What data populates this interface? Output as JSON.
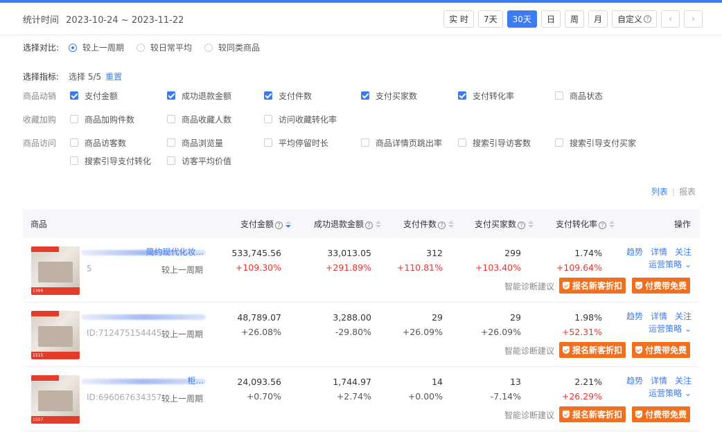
{
  "header": {
    "period_label": "统计时间",
    "period_value": "2023-10-24 ~ 2023-11-22",
    "ranges": [
      "实 时",
      "7天",
      "30天",
      "日",
      "周",
      "月",
      "自定义"
    ],
    "active_range": "30天",
    "prev_icon": "chevron-left-icon",
    "next_icon": "chevron-right-icon"
  },
  "compare": {
    "label": "选择对比:",
    "options": [
      "较上一周期",
      "较日常平均",
      "较同类商品"
    ],
    "selected": "较上一周期"
  },
  "indicators": {
    "label": "选择指标:",
    "count_text": "选择 5/5",
    "reset": "重置",
    "groups": [
      {
        "name": "商品动销",
        "items": [
          {
            "label": "支付金额",
            "checked": true
          },
          {
            "label": "成功退款金额",
            "checked": true
          },
          {
            "label": "支付件数",
            "checked": true
          },
          {
            "label": "支付买家数",
            "checked": true
          },
          {
            "label": "支付转化率",
            "checked": true
          },
          {
            "label": "商品状态",
            "checked": false
          }
        ]
      },
      {
        "name": "收藏加购",
        "items": [
          {
            "label": "商品加购件数",
            "checked": false
          },
          {
            "label": "商品收藏人数",
            "checked": false
          },
          {
            "label": "访问收藏转化率",
            "checked": false
          }
        ]
      },
      {
        "name": "商品访问",
        "items": [
          {
            "label": "商品访客数",
            "checked": false
          },
          {
            "label": "商品浏览量",
            "checked": false
          },
          {
            "label": "平均停留时长",
            "checked": false
          },
          {
            "label": "商品详情页跳出率",
            "checked": false
          },
          {
            "label": "搜索引导访客数",
            "checked": false
          },
          {
            "label": "搜索引导支付买家",
            "checked": false
          },
          {
            "label": "搜索引导支付转化",
            "checked": false
          },
          {
            "label": "访客平均价值",
            "checked": false
          }
        ]
      }
    ]
  },
  "view": {
    "list": "列表",
    "report": "报表",
    "sep": "|"
  },
  "table": {
    "headers": {
      "product": "商品",
      "pay_amount": "支付金额",
      "refund_amount": "成功退款金额",
      "pay_items": "支付件数",
      "pay_buyers": "支付买家数",
      "conv_rate": "支付转化率",
      "ops": "操作"
    },
    "rows": [
      {
        "name": "简约现代化妆...",
        "id": "5",
        "cmp": "较上一周期",
        "thumb_price": "1396",
        "pay_amount": "533,745.56",
        "pay_amount_chg": "+109.30%",
        "refund": "33,013.05",
        "refund_chg": "+291.89%",
        "items": "312",
        "items_chg": "+110.81%",
        "buyers": "299",
        "buyers_chg": "+103.40%",
        "rate": "1.74%",
        "rate_chg": "+109.64%"
      },
      {
        "name": "",
        "id": "ID:712475154445",
        "cmp": "较上一周期",
        "thumb_price": "1515",
        "pay_amount": "48,789.07",
        "pay_amount_chg": "+26.08%",
        "refund": "3,288.00",
        "refund_chg": "-29.80%",
        "items": "29",
        "items_chg": "+26.09%",
        "buyers": "29",
        "buyers_chg": "+26.09%",
        "rate": "1.98%",
        "rate_chg": "+52.31%"
      },
      {
        "name": "柜...",
        "id": "ID:696067634357",
        "cmp": "较上一周期",
        "thumb_price": "1507",
        "pay_amount": "24,093.56",
        "pay_amount_chg": "+0.70%",
        "refund": "1,744.97",
        "refund_chg": "+2.74%",
        "items": "14",
        "items_chg": "+0.00%",
        "buyers": "13",
        "buyers_chg": "-7.14%",
        "rate": "2.21%",
        "rate_chg": "+26.29%"
      }
    ],
    "row_ops": {
      "trend": "趋势",
      "detail": "详情",
      "follow": "关注",
      "strategy": "运营策略",
      "diag": "智能诊断建议",
      "btn1": "报名新客折扣",
      "btn2": "付费带免费"
    }
  },
  "colors": {
    "accent": "#3d7cf0",
    "up": "#e8322e",
    "orange": "#f07020"
  }
}
